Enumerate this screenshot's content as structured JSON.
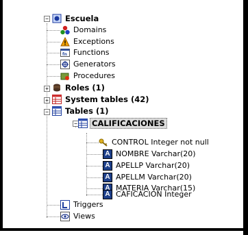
{
  "tree": {
    "database": "Escuela",
    "domains": "Domains",
    "exceptions": "Exceptions",
    "functions": "Functions",
    "generators": "Generators",
    "procedures": "Procedures",
    "roles": "Roles (1)",
    "system_tables": "System tables (42)",
    "tables": "Tables (1)",
    "table_name": "CALIFICACIONES",
    "columns": [
      "CONTROL Integer not null",
      "NOMBRE Varchar(20)",
      "APELLP Varchar(20)",
      "APELLM Varchar(20)",
      "MATERIA Varchar(15)",
      "CAFICACION Integer"
    ],
    "triggers": "Triggers",
    "views": "Views",
    "collapse_symbol": "−",
    "expand_symbol": "+"
  },
  "icons": {
    "database": "database-icon",
    "domains": "domains-icon",
    "exceptions": "warning-icon",
    "functions": "function-icon",
    "generators": "generator-icon",
    "procedures": "procedure-icon",
    "roles": "roles-icon",
    "system_tables": "system-table-icon",
    "tables": "tables-icon",
    "table": "table-icon",
    "key": "key-icon",
    "column": "column-icon",
    "triggers": "trigger-icon",
    "views": "views-icon"
  }
}
